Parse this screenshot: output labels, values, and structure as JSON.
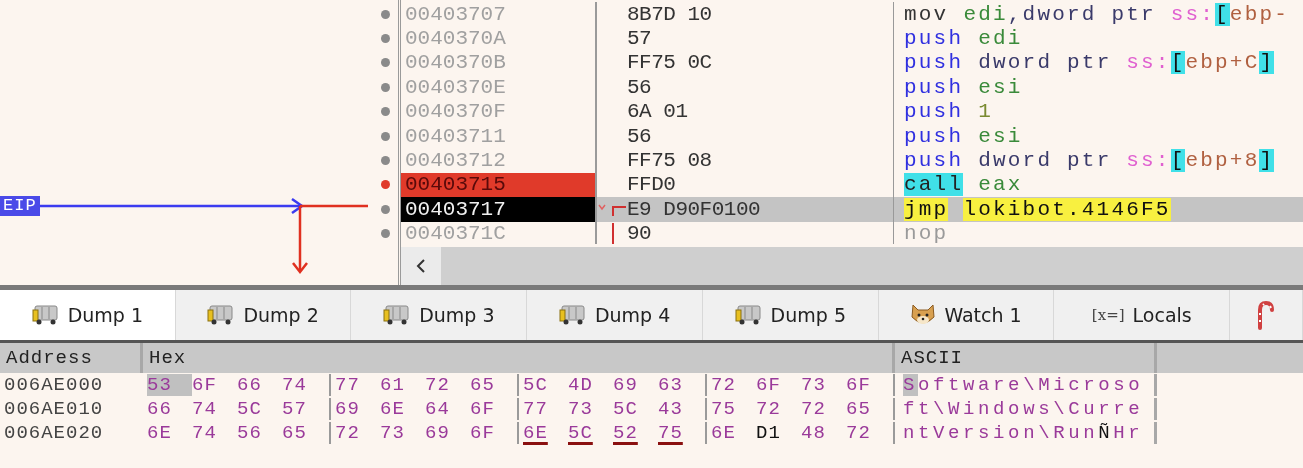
{
  "disassembly": {
    "eip_label": "EIP",
    "rows": [
      {
        "address": "00403707",
        "bytes": "8B7D 10",
        "breakpoint": false,
        "current": false,
        "kind": "plain",
        "tokens": [
          {
            "text": "mov",
            "kind": "op"
          },
          {
            "text": "edi",
            "kind": "reg"
          },
          {
            "text": ",dword ptr ",
            "kind": "plain"
          },
          {
            "text": "ss:",
            "kind": "seg"
          },
          {
            "text": "[",
            "kind": "bracket"
          },
          {
            "text": "ebp-",
            "kind": "mem"
          }
        ]
      },
      {
        "address": "0040370A",
        "bytes": "57",
        "breakpoint": false,
        "current": false,
        "kind": "plain",
        "tokens": [
          {
            "text": "push",
            "kind": "stack"
          },
          {
            "text": "edi",
            "kind": "reg"
          }
        ]
      },
      {
        "address": "0040370B",
        "bytes": "FF75 0C",
        "breakpoint": false,
        "current": false,
        "kind": "plain",
        "tokens": [
          {
            "text": "push",
            "kind": "stack"
          },
          {
            "text": "dword ptr ",
            "kind": "plain"
          },
          {
            "text": "ss:",
            "kind": "seg"
          },
          {
            "text": "[",
            "kind": "bracket"
          },
          {
            "text": "ebp+C",
            "kind": "mem"
          },
          {
            "text": "]",
            "kind": "bracket"
          }
        ]
      },
      {
        "address": "0040370E",
        "bytes": "56",
        "breakpoint": false,
        "current": false,
        "kind": "plain",
        "tokens": [
          {
            "text": "push",
            "kind": "stack"
          },
          {
            "text": "esi",
            "kind": "reg"
          }
        ]
      },
      {
        "address": "0040370F",
        "bytes": "6A 01",
        "breakpoint": false,
        "current": false,
        "kind": "plain",
        "tokens": [
          {
            "text": "push",
            "kind": "stack"
          },
          {
            "text": "1",
            "kind": "num"
          }
        ]
      },
      {
        "address": "00403711",
        "bytes": "56",
        "breakpoint": false,
        "current": false,
        "kind": "plain",
        "tokens": [
          {
            "text": "push",
            "kind": "stack"
          },
          {
            "text": "esi",
            "kind": "reg"
          }
        ]
      },
      {
        "address": "00403712",
        "bytes": "FF75 08",
        "breakpoint": false,
        "current": false,
        "kind": "plain",
        "tokens": [
          {
            "text": "push",
            "kind": "stack"
          },
          {
            "text": "dword ptr ",
            "kind": "plain"
          },
          {
            "text": "ss:",
            "kind": "seg"
          },
          {
            "text": "[",
            "kind": "bracket"
          },
          {
            "text": "ebp+8",
            "kind": "mem"
          },
          {
            "text": "]",
            "kind": "bracket"
          }
        ]
      },
      {
        "address": "00403715",
        "bytes": "FFD0",
        "breakpoint": true,
        "current": false,
        "kind": "plain",
        "tokens": [
          {
            "text": "call",
            "kind": "call"
          },
          {
            "text": "eax",
            "kind": "reg"
          }
        ]
      },
      {
        "address": "00403717",
        "bytes": "E9 D90F0100",
        "breakpoint": false,
        "current": true,
        "kind": "jump_start",
        "tokens": [
          {
            "text": "jmp",
            "kind": "jump"
          },
          {
            "text": "lokibot.4146F5",
            "kind": "target"
          }
        ]
      },
      {
        "address": "0040371C",
        "bytes": "90",
        "breakpoint": false,
        "current": false,
        "kind": "jump_through",
        "tokens": [
          {
            "text": "nop",
            "kind": "nop"
          }
        ]
      }
    ]
  },
  "tabs": [
    {
      "label": "Dump 1",
      "kind": "dump",
      "selected": true
    },
    {
      "label": "Dump 2",
      "kind": "dump",
      "selected": false
    },
    {
      "label": "Dump 3",
      "kind": "dump",
      "selected": false
    },
    {
      "label": "Dump 4",
      "kind": "dump",
      "selected": false
    },
    {
      "label": "Dump 5",
      "kind": "dump",
      "selected": false
    },
    {
      "label": "Watch 1",
      "kind": "watch",
      "selected": false
    },
    {
      "label": "Locals",
      "kind": "locals",
      "icon_text": "[x=]",
      "selected": false
    },
    {
      "kind": "candy",
      "selected": false
    }
  ],
  "dump": {
    "columns": [
      "Address",
      "Hex",
      "ASCII"
    ],
    "rows": [
      {
        "address": "006AE000",
        "ascii": "Software\\Microso",
        "bytes": [
          {
            "text": "53",
            "kind": "text",
            "selected": true,
            "underlined": false
          },
          {
            "text": "6F",
            "kind": "text",
            "selected": false,
            "underlined": false
          },
          {
            "text": "66",
            "kind": "text",
            "selected": false,
            "underlined": false
          },
          {
            "text": "74",
            "kind": "text",
            "selected": false,
            "underlined": false
          },
          {
            "text": "77",
            "kind": "text",
            "selected": false,
            "underlined": false
          },
          {
            "text": "61",
            "kind": "text",
            "selected": false,
            "underlined": false
          },
          {
            "text": "72",
            "kind": "text",
            "selected": false,
            "underlined": false
          },
          {
            "text": "65",
            "kind": "text",
            "selected": false,
            "underlined": false
          },
          {
            "text": "5C",
            "kind": "text",
            "selected": false,
            "underlined": false
          },
          {
            "text": "4D",
            "kind": "text",
            "selected": false,
            "underlined": false
          },
          {
            "text": "69",
            "kind": "text",
            "selected": false,
            "underlined": false
          },
          {
            "text": "63",
            "kind": "text",
            "selected": false,
            "underlined": false
          },
          {
            "text": "72",
            "kind": "text",
            "selected": false,
            "underlined": false
          },
          {
            "text": "6F",
            "kind": "text",
            "selected": false,
            "underlined": false
          },
          {
            "text": "73",
            "kind": "text",
            "selected": false,
            "underlined": false
          },
          {
            "text": "6F",
            "kind": "text",
            "selected": false,
            "underlined": false
          }
        ]
      },
      {
        "address": "006AE010",
        "ascii": "ft\\Windows\\Curre",
        "bytes": [
          {
            "text": "66",
            "kind": "text",
            "selected": false,
            "underlined": false
          },
          {
            "text": "74",
            "kind": "text",
            "selected": false,
            "underlined": false
          },
          {
            "text": "5C",
            "kind": "text",
            "selected": false,
            "underlined": false
          },
          {
            "text": "57",
            "kind": "text",
            "selected": false,
            "underlined": false
          },
          {
            "text": "69",
            "kind": "text",
            "selected": false,
            "underlined": false
          },
          {
            "text": "6E",
            "kind": "text",
            "selected": false,
            "underlined": false
          },
          {
            "text": "64",
            "kind": "text",
            "selected": false,
            "underlined": false
          },
          {
            "text": "6F",
            "kind": "text",
            "selected": false,
            "underlined": false
          },
          {
            "text": "77",
            "kind": "text",
            "selected": false,
            "underlined": false
          },
          {
            "text": "73",
            "kind": "text",
            "selected": false,
            "underlined": false
          },
          {
            "text": "5C",
            "kind": "text",
            "selected": false,
            "underlined": false
          },
          {
            "text": "43",
            "kind": "text",
            "selected": false,
            "underlined": false
          },
          {
            "text": "75",
            "kind": "text",
            "selected": false,
            "underlined": false
          },
          {
            "text": "72",
            "kind": "text",
            "selected": false,
            "underlined": false
          },
          {
            "text": "72",
            "kind": "text",
            "selected": false,
            "underlined": false
          },
          {
            "text": "65",
            "kind": "text",
            "selected": false,
            "underlined": false
          }
        ]
      },
      {
        "address": "006AE020",
        "ascii": "ntVersion\\RunÑHr",
        "bytes": [
          {
            "text": "6E",
            "kind": "text",
            "selected": false,
            "underlined": false
          },
          {
            "text": "74",
            "kind": "text",
            "selected": false,
            "underlined": false
          },
          {
            "text": "56",
            "kind": "text",
            "selected": false,
            "underlined": false
          },
          {
            "text": "65",
            "kind": "text",
            "selected": false,
            "underlined": false
          },
          {
            "text": "72",
            "kind": "text",
            "selected": false,
            "underlined": false
          },
          {
            "text": "73",
            "kind": "text",
            "selected": false,
            "underlined": false
          },
          {
            "text": "69",
            "kind": "text",
            "selected": false,
            "underlined": false
          },
          {
            "text": "6F",
            "kind": "text",
            "selected": false,
            "underlined": false
          },
          {
            "text": "6E",
            "kind": "text",
            "selected": false,
            "underlined": true
          },
          {
            "text": "5C",
            "kind": "text",
            "selected": false,
            "underlined": true
          },
          {
            "text": "52",
            "kind": "text",
            "selected": false,
            "underlined": true
          },
          {
            "text": "75",
            "kind": "text",
            "selected": false,
            "underlined": true
          },
          {
            "text": "6E",
            "kind": "text",
            "selected": false,
            "underlined": false
          },
          {
            "text": "D1",
            "kind": "other",
            "selected": false,
            "underlined": false
          },
          {
            "text": "48",
            "kind": "text",
            "selected": false,
            "underlined": false
          },
          {
            "text": "72",
            "kind": "text",
            "selected": false,
            "underlined": false
          }
        ]
      }
    ]
  }
}
